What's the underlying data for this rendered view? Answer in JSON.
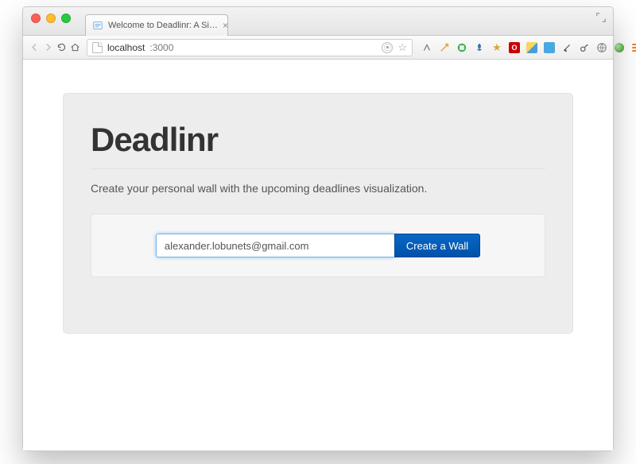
{
  "browser": {
    "tab_title": "Welcome to Deadlinr: A Si…",
    "url_host": "localhost",
    "url_rest": ":3000"
  },
  "page": {
    "brand": "Deadlinr",
    "tagline": "Create your personal wall with the upcoming deadlines visualization.",
    "email_value": "alexander.lobunets@gmail.com",
    "create_label": "Create a Wall"
  }
}
